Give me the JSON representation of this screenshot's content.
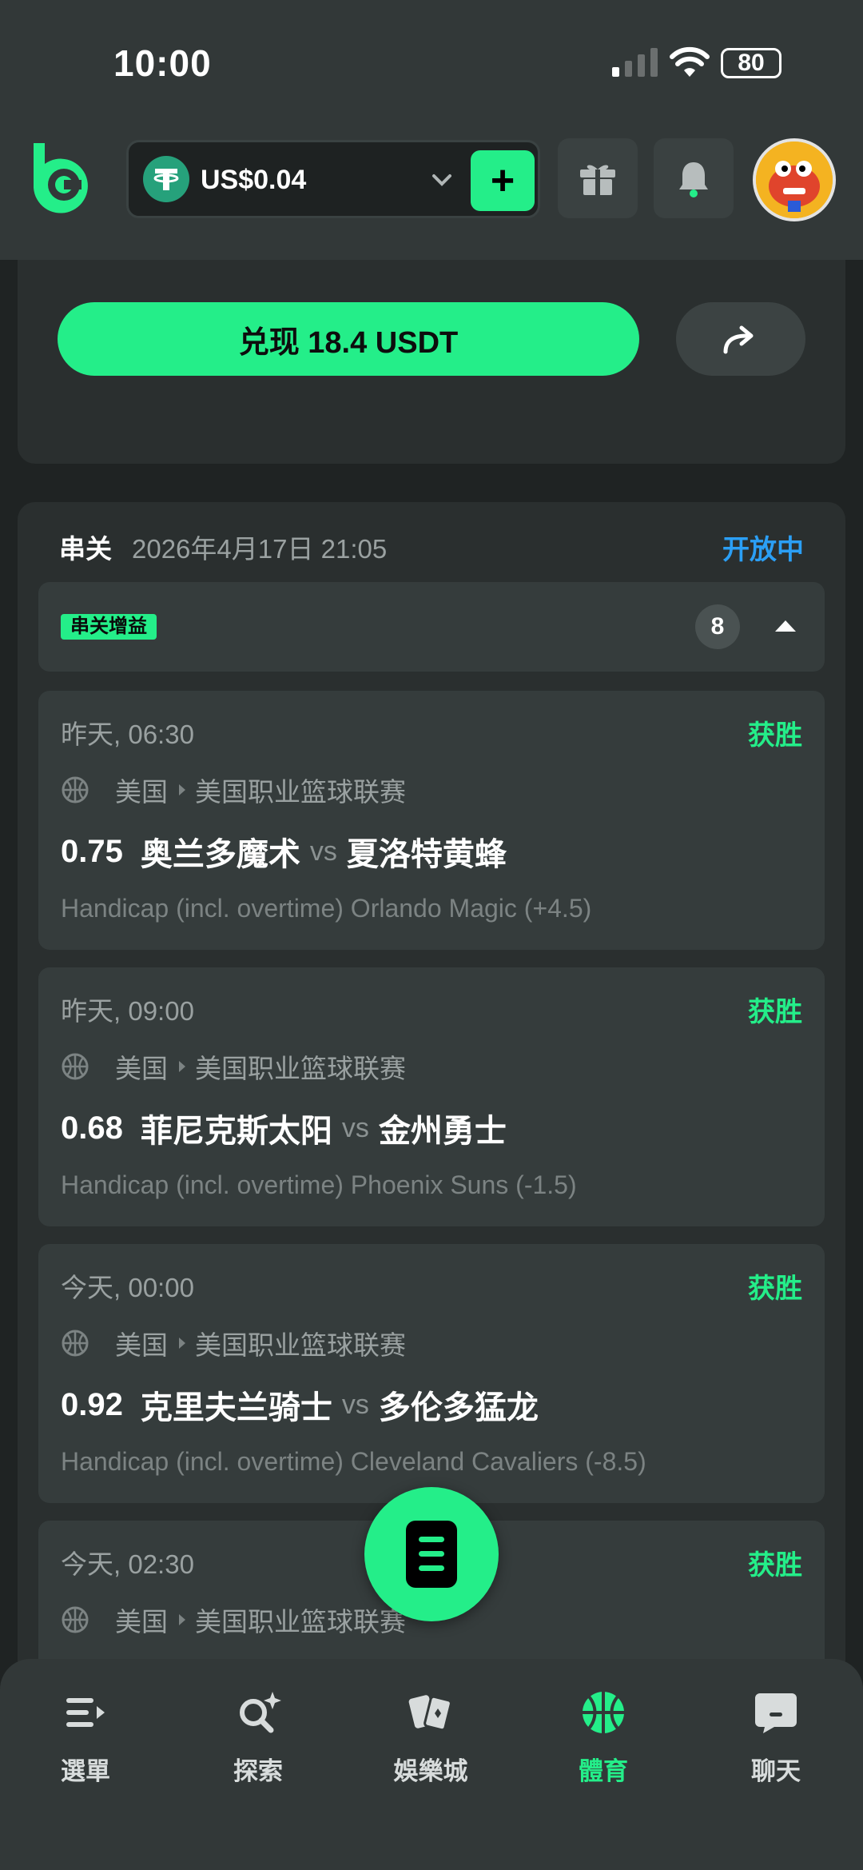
{
  "status_bar": {
    "time": "10:00",
    "battery": "80"
  },
  "header": {
    "balance": "US$0.04",
    "add_label": "+",
    "icons": [
      "logo-icon",
      "tether-icon",
      "chevron-down-icon",
      "gift-icon",
      "bell-icon",
      "avatar"
    ]
  },
  "cashout": {
    "label": "兑现 18.4 USDT"
  },
  "bet": {
    "type": "串关",
    "date": "2026年4月17日 21:05",
    "status": "开放中",
    "boost_label": "串关增益",
    "legs_count": "8",
    "legs": [
      {
        "time": "昨天, 06:30",
        "result": "获胜",
        "country": "美国",
        "league": "美国职业篮球联赛",
        "odds": "0.75",
        "home": "奥兰多魔术",
        "vs": "vs",
        "away": "夏洛特黄蜂",
        "market": "Handicap (incl. overtime) Orlando Magic (+4.5)"
      },
      {
        "time": "昨天, 09:00",
        "result": "获胜",
        "country": "美国",
        "league": "美国职业篮球联赛",
        "odds": "0.68",
        "home": "菲尼克斯太阳",
        "vs": "vs",
        "away": "金州勇士",
        "market": "Handicap (incl. overtime) Phoenix Suns (-1.5)"
      },
      {
        "time": "今天, 00:00",
        "result": "获胜",
        "country": "美国",
        "league": "美国职业篮球联赛",
        "odds": "0.92",
        "home": "克里夫兰骑士",
        "vs": "vs",
        "away": "多伦多猛龙",
        "market": "Handicap (incl. overtime) Cleveland Cavaliers (-8.5)"
      },
      {
        "time": "今天, 02:30",
        "result": "获胜",
        "country": "美国",
        "league": "美国职业篮球联赛"
      }
    ]
  },
  "nav": [
    {
      "label": "選單",
      "icon": "menu-icon"
    },
    {
      "label": "探索",
      "icon": "search-sparkle-icon"
    },
    {
      "label": "娛樂城",
      "icon": "cards-icon"
    },
    {
      "label": "體育",
      "icon": "basketball-icon",
      "active": true
    },
    {
      "label": "聊天",
      "icon": "chat-icon"
    }
  ],
  "colors": {
    "accent": "#24ee89",
    "status_blue": "#2b9ff5",
    "bg": "#1f2323",
    "card": "#2a2f2f",
    "leg": "#353c3c"
  }
}
